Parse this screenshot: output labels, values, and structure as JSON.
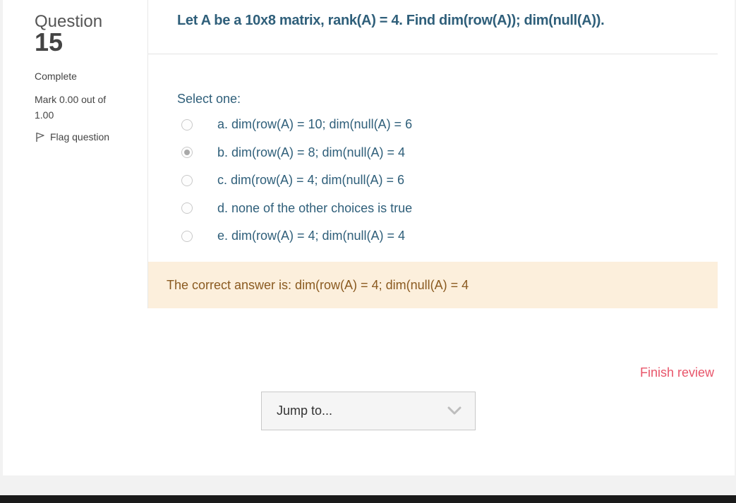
{
  "info": {
    "question_label": "Question",
    "question_number": "15",
    "state": "Complete",
    "grade": "Mark 0.00 out of 1.00",
    "flag_label": "Flag question"
  },
  "question": {
    "text": "Let A be a 10x8 matrix, rank(A) = 4. Find dim(row(A)); dim(null(A)).",
    "prompt": "Select one:",
    "answers": [
      {
        "label": "a. dim(row(A) = 10; dim(null(A) = 6",
        "checked": false
      },
      {
        "label": "b. dim(row(A) = 8; dim(null(A) = 4",
        "checked": true
      },
      {
        "label": "c. dim(row(A) = 4; dim(null(A) = 6",
        "checked": false
      },
      {
        "label": "d. none of the other choices is true",
        "checked": false
      },
      {
        "label": "e. dim(row(A) = 4; dim(null(A) = 4",
        "checked": false
      }
    ]
  },
  "feedback": {
    "right_answer": "The correct answer is: dim(row(A) = 4; dim(null(A) = 4"
  },
  "navigation": {
    "finish_review": "Finish review",
    "jump_to": "Jump to..."
  },
  "icons": {
    "flag": "flag-icon",
    "dropdown": "chevron-down-icon"
  },
  "colors": {
    "question_text": "#2f5f7a",
    "feedback_bg": "#fcefdc",
    "finish_link": "#e8556a"
  }
}
